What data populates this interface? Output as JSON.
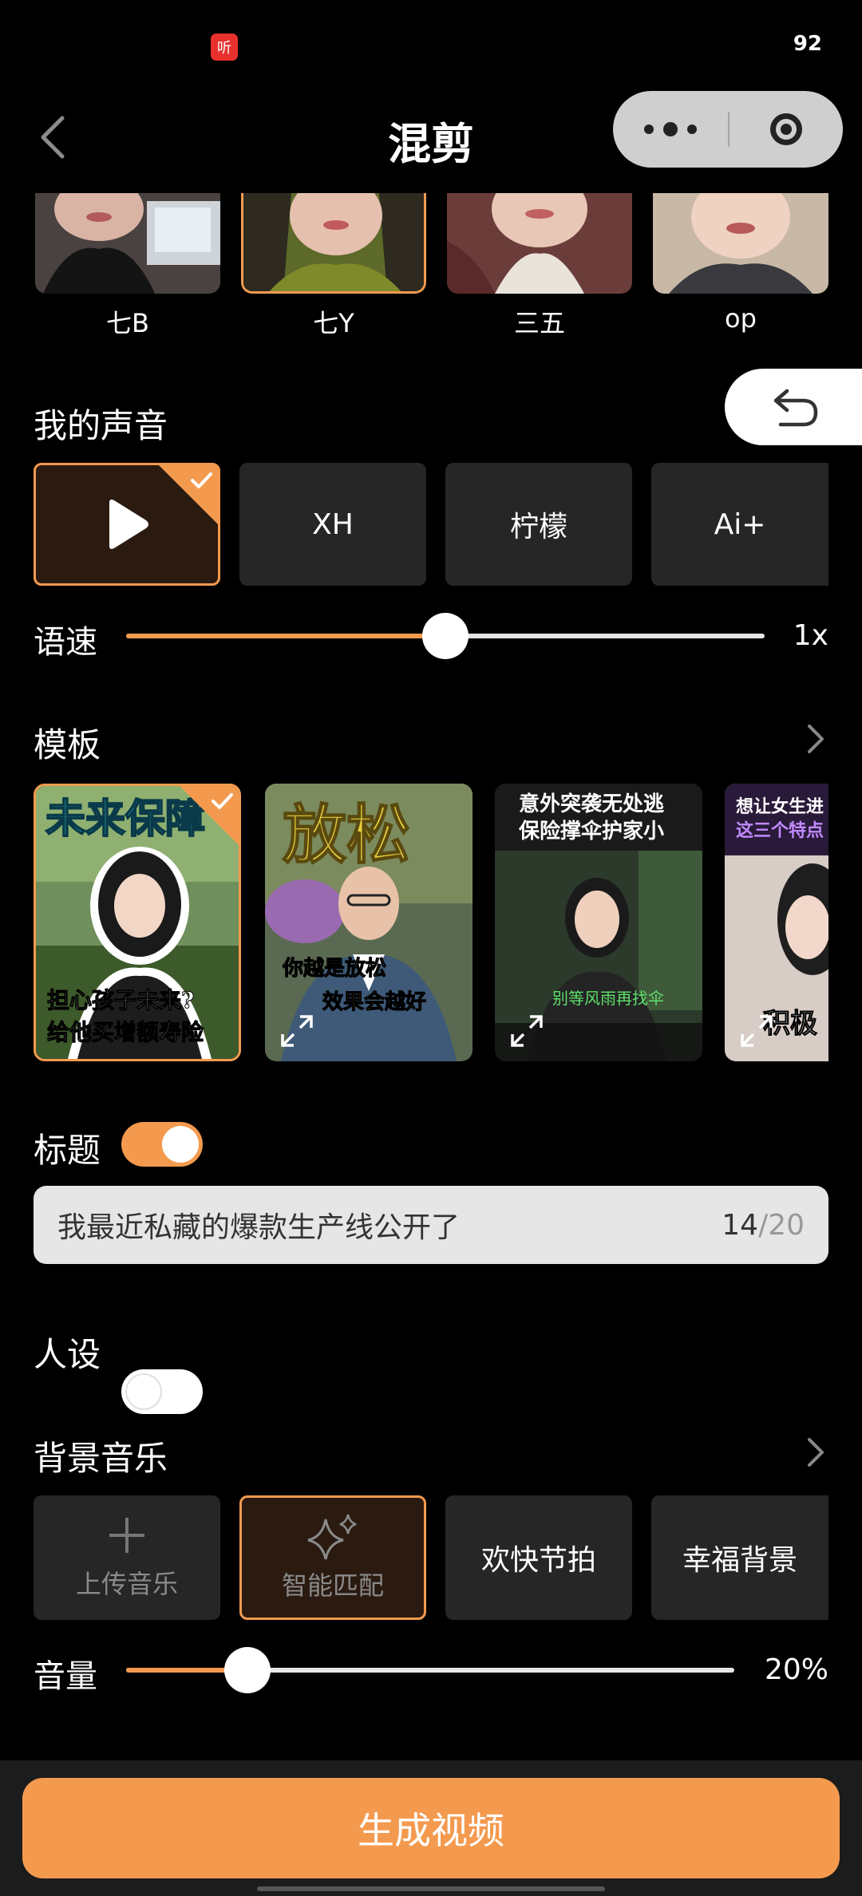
{
  "status": {
    "app_icon_label": "听",
    "battery": "92"
  },
  "header": {
    "title": "混剪"
  },
  "avatars": [
    {
      "name": "七B",
      "selected": false
    },
    {
      "name": "七Y",
      "selected": true
    },
    {
      "name": "三五",
      "selected": false
    },
    {
      "name": "op",
      "selected": false
    }
  ],
  "voice": {
    "label": "我的声音",
    "options": [
      {
        "label": "",
        "selected": true,
        "icon": "play-icon"
      },
      {
        "label": "XH",
        "selected": false
      },
      {
        "label": "柠檬",
        "selected": false
      },
      {
        "label": "Ai+",
        "selected": false
      }
    ]
  },
  "speed": {
    "label": "语速",
    "value_text": "1x",
    "level": 0.5
  },
  "templates": {
    "label": "模板",
    "items": [
      {
        "top_text": "未来保障",
        "caption_1": "担心孩子未来?",
        "caption_2": "给他买增额寿险",
        "selected": true
      },
      {
        "top_text": "放松",
        "caption_1": "你越是放松",
        "caption_2": "效果会越好",
        "selected": false
      },
      {
        "top_text": "意外突袭无处逃",
        "top_text_2": "保险撑伞护家小",
        "caption_1": "别等风雨再找伞",
        "selected": false
      },
      {
        "top_text": "想让女生进",
        "top_text_2": "这三个特点",
        "caption_1": "积极",
        "selected": false
      }
    ]
  },
  "title_section": {
    "label": "标题",
    "enabled": true,
    "value": "我最近私藏的爆款生产线公开了",
    "count": "14",
    "max": "/20"
  },
  "persona": {
    "label": "人设",
    "enabled": false
  },
  "music": {
    "label": "背景音乐",
    "options": [
      {
        "label": "上传音乐",
        "icon": "plus-icon"
      },
      {
        "label": "智能匹配",
        "icon": "sparkle-icon",
        "selected": true
      },
      {
        "label": "欢快节拍"
      },
      {
        "label": "幸福背景"
      }
    ]
  },
  "volume": {
    "label": "音量",
    "value_text": "20%",
    "level": 0.2
  },
  "generate": {
    "label": "生成视频"
  },
  "colors": {
    "accent": "#f39a4f",
    "card": "#262626",
    "selected_card": "#2b1a10"
  }
}
